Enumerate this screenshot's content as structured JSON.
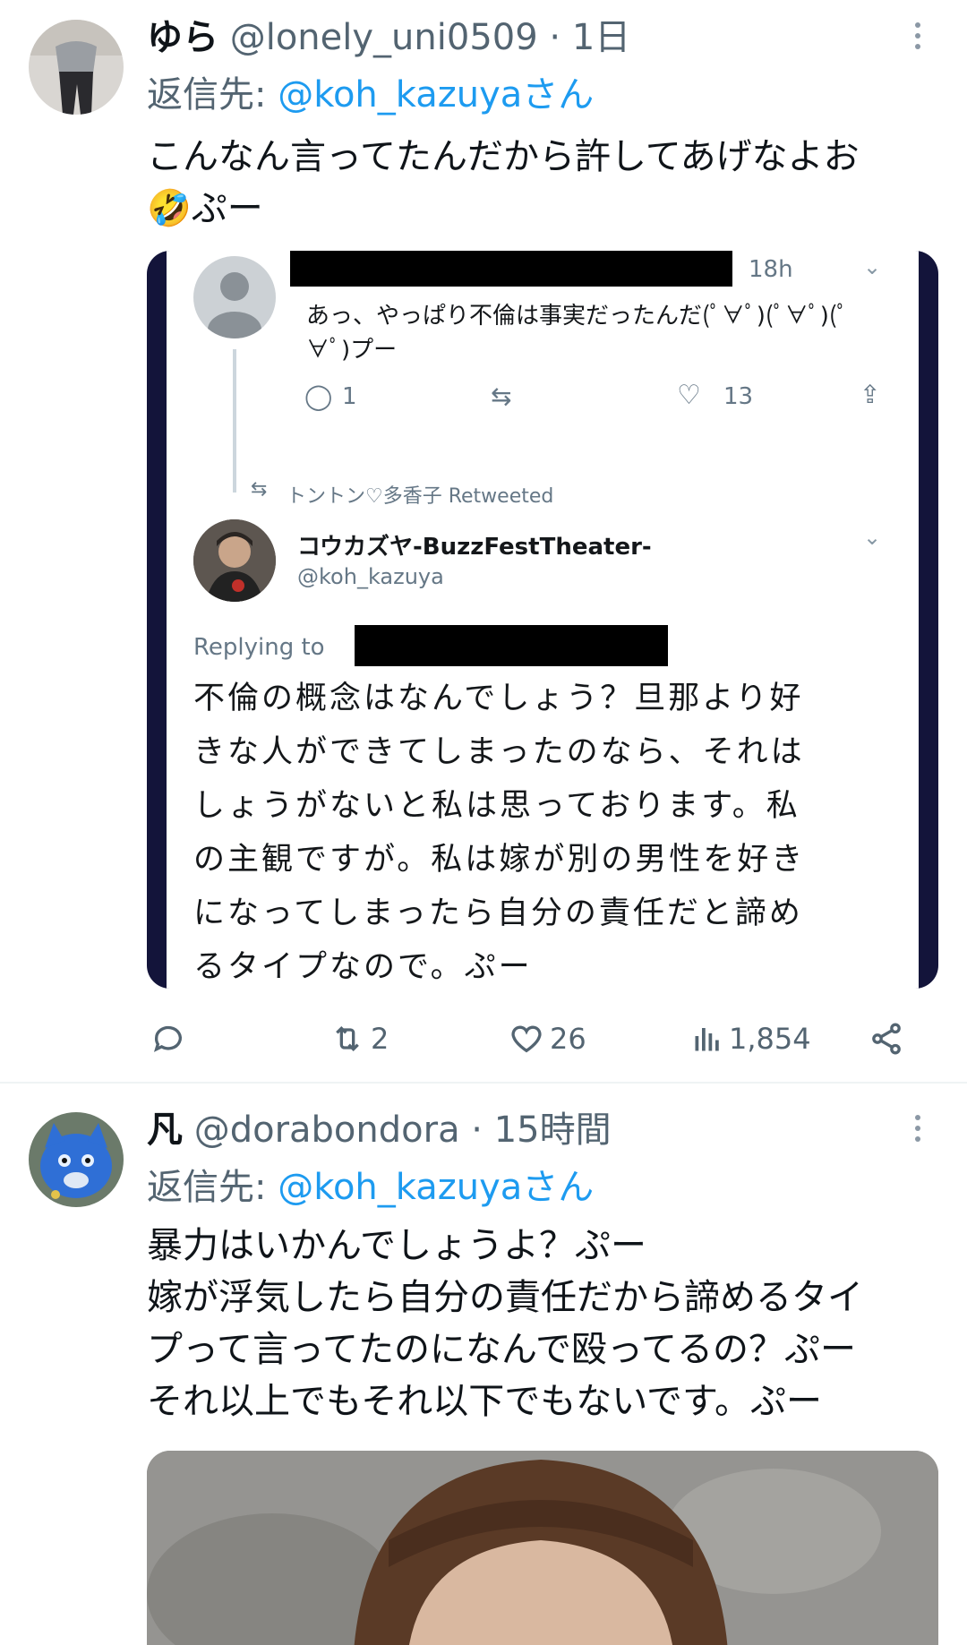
{
  "tweets": [
    {
      "name": "ゆら",
      "handle": "@lonely_uni0509",
      "dot": "·",
      "time": "1日",
      "reply_prefix": "返信先: ",
      "reply_mention": "@koh_kazuyaさん",
      "text_lines": [
        "こんなん言ってたんだから許してあげなよお",
        "🤣ぷー"
      ],
      "actions": {
        "replies": "",
        "retweets": "2",
        "likes": "26",
        "views": "1,854"
      }
    },
    {
      "name": "凡",
      "handle": "@dorabondora",
      "dot": "·",
      "time": "15時間",
      "reply_prefix": "返信先: ",
      "reply_mention": "@koh_kazuyaさん",
      "text_lines": [
        "暴力はいかんでしょうよ？ぷー",
        "嫁が浮気したら自分の責任だから諦めるタイ",
        "プって言ってたのになんで殴ってるの？ぷー",
        "それ以上でもそれ以下でもないです。ぷー"
      ]
    }
  ],
  "embed": {
    "top_time": "18h",
    "top_text_1": "あっ、やっぱり不倫は事実だったんだ(ﾟ∀ﾟ)(ﾟ∀ﾟ)(ﾟ",
    "top_text_2": "∀ﾟ)プー",
    "top_reply_count": "1",
    "top_like_count": "13",
    "retweeted_by": "トントン♡多香子 Retweeted",
    "author_name": "コウカズヤ-BuzzFestTheater-",
    "author_handle": "@koh_kazuya",
    "replying_to": "Replying to",
    "body_lines": [
      "不倫の概念はなんでしょう？旦那より好",
      "きな人ができてしまったのなら、それは",
      "しょうがないと私は思っております。私",
      "の主観ですが。私は嫁が別の男性を好き",
      "になってしまったら自分の責任だと諦め",
      "るタイプなので。ぷー"
    ]
  },
  "icons": [
    "more-icon",
    "reply-icon",
    "retweet-icon",
    "like-icon",
    "views-icon",
    "share-icon"
  ],
  "colors": {
    "link": "#1d9bf0",
    "secondary": "#536471",
    "embed_frame": "#13143a"
  }
}
